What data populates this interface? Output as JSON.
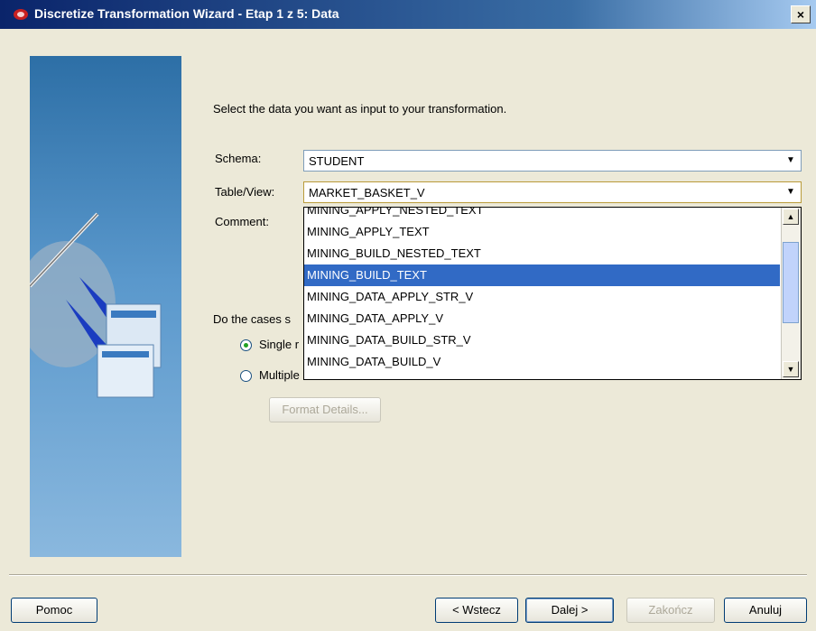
{
  "window": {
    "title": "Discretize Transformation Wizard - Etap 1 z 5: Data",
    "close_label": "×"
  },
  "intro": "Select the data you want as input to your transformation.",
  "schema": {
    "label": "Schema:",
    "value": "STUDENT"
  },
  "table_view": {
    "label": "Table/View:",
    "value": "MARKET_BASKET_V"
  },
  "comment": {
    "label": "Comment:"
  },
  "dropdown": {
    "items": [
      "MINING_APPLY_NESTED_TEXT",
      "MINING_APPLY_TEXT",
      "MINING_BUILD_NESTED_TEXT",
      "MINING_BUILD_TEXT",
      "MINING_DATA_APPLY_STR_V",
      "MINING_DATA_APPLY_V",
      "MINING_DATA_BUILD_STR_V",
      "MINING_DATA_BUILD_V"
    ],
    "selected_index": 3
  },
  "cases": {
    "question": "Do the cases s",
    "single_label": "Single r",
    "multiple_label": "Multiple",
    "selected": "single"
  },
  "format_details_label": "Format Details...",
  "footer": {
    "help": "Pomoc",
    "back": "< Wstecz",
    "next": "Dalej >",
    "finish": "Zakończ",
    "cancel": "Anuluj"
  }
}
